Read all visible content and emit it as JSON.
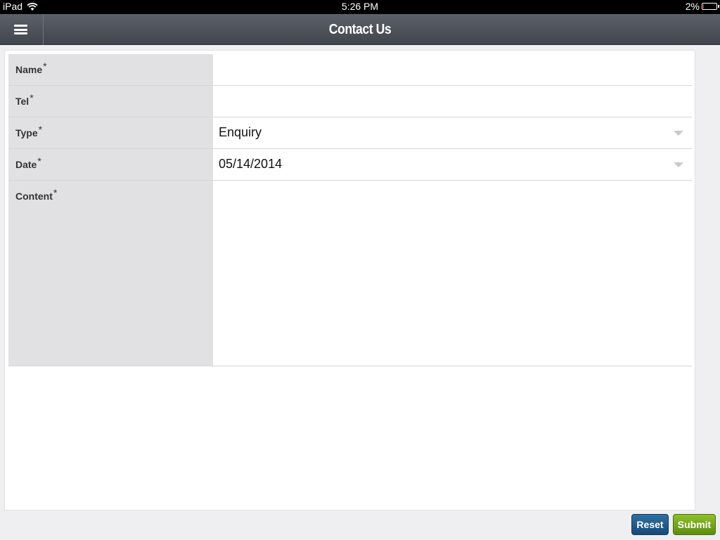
{
  "status_bar": {
    "device": "iPad",
    "time": "5:26 PM",
    "battery": "2%",
    "battery_level": 0.02
  },
  "header": {
    "title": "Contact Us",
    "menu_icon": "hamburger-menu-icon"
  },
  "form": {
    "required_marker": "*",
    "fields": [
      {
        "label": "Name",
        "value": ""
      },
      {
        "label": "Tel",
        "value": ""
      },
      {
        "label": "Type",
        "value": "Enquiry"
      },
      {
        "label": "Date",
        "value": "05/14/2014"
      },
      {
        "label": "Content",
        "value": ""
      }
    ]
  },
  "actions": {
    "reset_label": "Reset",
    "submit_label": "Submit",
    "reset_color": "#1d5585",
    "submit_color": "#74a41c"
  }
}
